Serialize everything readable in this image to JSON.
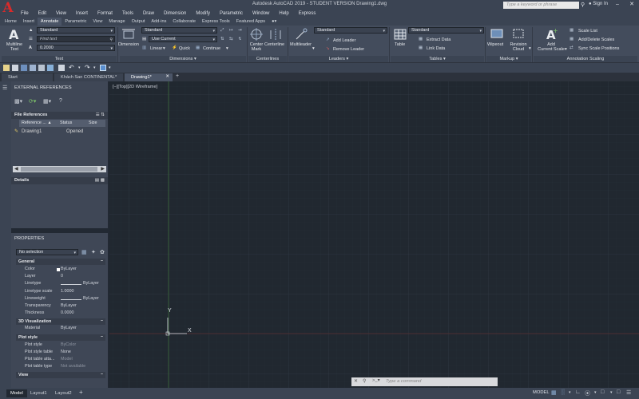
{
  "window": {
    "title": "Autodesk AutoCAD 2019 - STUDENT VERSION    Drawing1.dwg",
    "search_placeholder": "Type a keyword or phrase",
    "sign_in": "Sign In",
    "logo_letter": "A"
  },
  "menu": [
    "File",
    "Edit",
    "View",
    "Insert",
    "Format",
    "Tools",
    "Draw",
    "Dimension",
    "Modify",
    "Parametric",
    "Window",
    "Help",
    "Express"
  ],
  "ribbon_tabs": [
    "Home",
    "Insert",
    "Annotate",
    "Parametric",
    "View",
    "Manage",
    "Output",
    "Add-ins",
    "Collaborate",
    "Express Tools",
    "Featured Apps"
  ],
  "ribbon_active_tab": "Annotate",
  "ribbon": {
    "text": {
      "multiline_text": [
        "Multiline",
        "Text"
      ],
      "style": "Standard",
      "find_text": "Find text",
      "height": "0.2000",
      "label": "Text"
    },
    "dimensions": {
      "dimension": "Dimension",
      "style": "Standard",
      "use_current": "Use Current",
      "linear": "Linear",
      "quick": "Quick",
      "continue": "Continue",
      "label": "Dimensions"
    },
    "centerlines": {
      "center_mark": [
        "Center",
        "Mark"
      ],
      "centerline": "Centerline",
      "label": "Centerlines"
    },
    "leaders": {
      "multileader": "Multileader",
      "style": "Standard",
      "add_leader": "Add Leader",
      "remove_leader": "Remove Leader",
      "label": "Leaders"
    },
    "tables": {
      "table": "Table",
      "style": "Standard",
      "extract_data": "Extract Data",
      "link_data": "Link Data",
      "label": "Tables"
    },
    "markup": {
      "wipeout": "Wipeout",
      "revision_cloud": [
        "Revision",
        "Cloud"
      ],
      "label": "Markup"
    },
    "annotation_scaling": {
      "add_current_scale": [
        "Add",
        "Current Scale"
      ],
      "scale_list": "Scale List",
      "add_delete_scales": "Add/Delete Scales",
      "sync_scale_positions": "Sync Scale Positions",
      "label": "Annotation Scaling"
    }
  },
  "doc_tabs": [
    "Start",
    "Khách San CONTINENTAL*",
    "Drawing1*"
  ],
  "doc_active_tab": "Drawing1*",
  "xref_palette": {
    "title": "EXTERNAL REFERENCES",
    "file_refs_header": "File References",
    "columns": [
      "Reference ...",
      "Status",
      "Size"
    ],
    "rows": [
      {
        "name": "Drawing1",
        "status": "Opened",
        "size": ""
      }
    ],
    "details_header": "Details"
  },
  "properties_palette": {
    "title": "PROPERTIES",
    "selection": "No selection",
    "sections": {
      "general": "General",
      "viz3d": "3D Visualization",
      "plot_style": "Plot style",
      "view": "View"
    },
    "general": [
      {
        "name": "Color",
        "value": "ByLayer"
      },
      {
        "name": "Layer",
        "value": "0"
      },
      {
        "name": "Linetype",
        "value": "ByLayer"
      },
      {
        "name": "Linetype scale",
        "value": "1.0000"
      },
      {
        "name": "Lineweight",
        "value": "ByLayer"
      },
      {
        "name": "Transparency",
        "value": "ByLayer"
      },
      {
        "name": "Thickness",
        "value": "0.0000"
      }
    ],
    "viz3d": [
      {
        "name": "Material",
        "value": "ByLayer"
      }
    ],
    "plot": [
      {
        "name": "Plot style",
        "value": "ByColor"
      },
      {
        "name": "Plot style table",
        "value": "None"
      },
      {
        "name": "Plot table atta...",
        "value": "Model"
      },
      {
        "name": "Plot table type",
        "value": "Not available"
      }
    ]
  },
  "viewport_label": "[−][Top][2D Wireframe]",
  "ucs": {
    "x": "X",
    "y": "Y"
  },
  "command_placeholder": "Type a command",
  "layout_tabs": [
    "Model",
    "Layout1",
    "Layout2"
  ],
  "status_model": "MODEL"
}
